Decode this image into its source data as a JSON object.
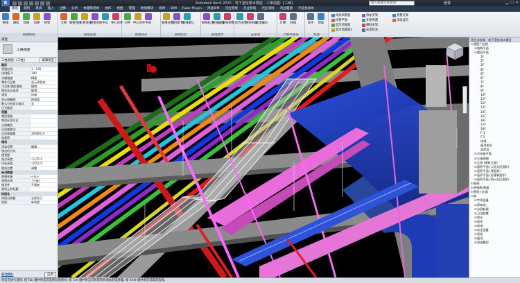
{
  "app": {
    "title": "Autodesk Revit 2016 - 地下室给排水模型 - 三维视图: {三维}",
    "search_placeholder": "键入关键字或短语",
    "login_label": "登录",
    "app_button": "R"
  },
  "tabs": [
    "建筑",
    "结构",
    "系统",
    "插入",
    "注释",
    "分析",
    "体量和场地",
    "协作",
    "视图",
    "管理",
    "附加模块",
    "修改",
    "BIM",
    "Fuzor Plugin",
    "鸿业BIM",
    "鸿业管线",
    "鸿业机电",
    "鸿业消防",
    "鸿业暖通",
    "鸿业给排水"
  ],
  "active_tab": 0,
  "ribbon": {
    "groups": [
      {
        "label": "管线绘制",
        "buttons": [
          "管线",
          "通风",
          "喷淋",
          "风管",
          "桥架"
        ]
      },
      {
        "label": "管线连接",
        "buttons": [
          "立管",
          "两管连接",
          "三管连接",
          "四管连接",
          "中心",
          "中心对齐"
        ]
      },
      {
        "label": "管线对齐",
        "buttons": [
          "对齐",
          "中心对齐",
          "中间",
          "管线平移"
        ]
      },
      {
        "label": "管线综合",
        "buttons": [
          "管线分割",
          "管线打断",
          "管线避让",
          "管线调整"
        ]
      },
      {
        "label": "管线修改",
        "buttons": [
          "管线标注",
          "管线编辑",
          "管线参数"
        ]
      },
      {
        "label": "支吊架",
        "buttons": [
          "综合支架",
          "吊架布置",
          "支架编号"
        ]
      },
      {
        "label": "计算书管理",
        "buttons": [
          "计算",
          "校核"
        ]
      },
      {
        "label": "帮助",
        "buttons": [
          "关于",
          "帮助",
          "授权"
        ]
      }
    ],
    "small_items": [
      "添加风管面",
      "风管平面",
      "显示风管面",
      "显示风管面2",
      "添加支架",
      "支架布置",
      "删除支架",
      "支架标注",
      "查看支架",
      "净高显示"
    ]
  },
  "properties": {
    "header": "属性",
    "type_name": "三维视图",
    "selector": "三维视图: {三维}",
    "edit_type": "编辑类型",
    "rows": [
      {
        "cat": "图形"
      },
      {
        "k": "视图比例",
        "v": "1 : 100"
      },
      {
        "k": "比例值 1:",
        "v": "100"
      },
      {
        "k": "详细程度",
        "v": "精细"
      },
      {
        "k": "零件可见性",
        "v": "显示原状态"
      },
      {
        "k": "可见性/图形替换",
        "v": "编辑..."
      },
      {
        "k": "图形显示选项",
        "v": "编辑..."
      },
      {
        "k": "规程",
        "v": "协调"
      },
      {
        "k": "显示隐藏线",
        "v": "按规程"
      },
      {
        "k": "默认分析显示样式",
        "v": "无"
      },
      {
        "k": "日光路径",
        "v": ""
      },
      {
        "cat": "范围"
      },
      {
        "k": "裁剪视图",
        "v": ""
      },
      {
        "k": "裁剪区域可见",
        "v": ""
      },
      {
        "k": "注释裁剪",
        "v": ""
      },
      {
        "k": "远剪裁激活",
        "v": ""
      },
      {
        "k": "远剪裁偏移",
        "v": "304800.0"
      },
      {
        "k": "剖面框",
        "v": ""
      },
      {
        "cat": "相机"
      },
      {
        "k": "渲染设置",
        "v": "编辑..."
      },
      {
        "k": "锁定的方向",
        "v": ""
      },
      {
        "k": "透视图",
        "v": ""
      },
      {
        "k": "视点高度",
        "v": "-1175.2"
      },
      {
        "k": "目标高度",
        "v": "-2552.5"
      },
      {
        "k": "相机位置",
        "v": "调整"
      },
      {
        "cat": "标识数据"
      },
      {
        "k": "视图样板",
        "v": "<无>"
      },
      {
        "k": "视图名称",
        "v": "{三维}"
      },
      {
        "k": "相关性",
        "v": "不相关"
      },
      {
        "k": "图纸上的标题",
        "v": ""
      },
      {
        "cat": "阶段化"
      },
      {
        "k": "阶段过滤器",
        "v": "全部显示"
      },
      {
        "k": "阶段",
        "v": "新构造"
      }
    ],
    "help_link": "属性帮助",
    "apply_label": "应用"
  },
  "browser": {
    "header": "项目浏览器 - 地下室给排水模型",
    "items": [
      {
        "t": "视图 (全部)",
        "lvl": 0,
        "g": "⊟"
      },
      {
        "t": "结构平面",
        "lvl": 1,
        "g": "⊞"
      },
      {
        "t": "楼层平面",
        "lvl": 1,
        "g": "⊟"
      },
      {
        "t": "1F",
        "lvl": 2,
        "g": ""
      },
      {
        "t": "2F",
        "lvl": 2,
        "g": ""
      },
      {
        "t": "3F",
        "lvl": 2,
        "g": ""
      },
      {
        "t": "4F",
        "lvl": 2,
        "g": ""
      },
      {
        "t": "5F",
        "lvl": 2,
        "g": ""
      },
      {
        "t": "6F",
        "lvl": 2,
        "g": ""
      },
      {
        "t": "7F",
        "lvl": 2,
        "g": ""
      },
      {
        "t": "8F",
        "lvl": 2,
        "g": ""
      },
      {
        "t": "9F",
        "lvl": 2,
        "g": ""
      },
      {
        "t": "10F",
        "lvl": 2,
        "g": ""
      },
      {
        "t": "11F",
        "lvl": 2,
        "g": ""
      },
      {
        "t": "12F",
        "lvl": 2,
        "g": ""
      },
      {
        "t": "13F",
        "lvl": 2,
        "g": ""
      },
      {
        "t": "14F",
        "lvl": 2,
        "g": ""
      },
      {
        "t": "15F",
        "lvl": 2,
        "g": ""
      },
      {
        "t": "16F",
        "lvl": 2,
        "g": ""
      },
      {
        "t": "17F",
        "lvl": 2,
        "g": ""
      },
      {
        "t": "18F",
        "lvl": 2,
        "g": ""
      },
      {
        "t": "F-1",
        "lvl": 2,
        "g": ""
      },
      {
        "t": "F-2",
        "lvl": 2,
        "g": ""
      },
      {
        "t": "场地",
        "lvl": 2,
        "g": ""
      },
      {
        "t": "屋顶排水",
        "lvl": 2,
        "g": ""
      },
      {
        "t": "机房层",
        "lvl": 2,
        "g": ""
      },
      {
        "t": "天花板平面",
        "lvl": 1,
        "g": "⊞"
      },
      {
        "t": "三维视图",
        "lvl": 1,
        "g": "⊞"
      },
      {
        "t": "立面 (建筑立面)",
        "lvl": 1,
        "g": "⊞"
      },
      {
        "t": "面积平面 (人防分区面积)",
        "lvl": 1,
        "g": "⊞"
      },
      {
        "t": "面积平面 (净面积)",
        "lvl": 1,
        "g": "⊞"
      },
      {
        "t": "面积平面 (总建筑面积)",
        "lvl": 1,
        "g": "⊞"
      },
      {
        "t": "面积平面 (防火分区面积)",
        "lvl": 1,
        "g": "⊞"
      },
      {
        "t": "图例",
        "lvl": 0,
        "g": "⊞"
      },
      {
        "t": "明细表/数量",
        "lvl": 0,
        "g": "⊞"
      },
      {
        "t": "图纸 (全部)",
        "lvl": 0,
        "g": "⊞"
      },
      {
        "t": "族",
        "lvl": 0,
        "g": "⊟"
      },
      {
        "t": "专用设备",
        "lvl": 1,
        "g": "⊞"
      },
      {
        "t": "停车场",
        "lvl": 1,
        "g": "⊞"
      },
      {
        "t": "分割轮廓",
        "lvl": 1,
        "g": "⊞"
      },
      {
        "t": "卫浴装置",
        "lvl": 1,
        "g": "⊞"
      },
      {
        "t": "喷头",
        "lvl": 1,
        "g": "⊞"
      },
      {
        "t": "地形",
        "lvl": 1,
        "g": "⊞"
      },
      {
        "t": "场地",
        "lvl": 1,
        "g": "⊞"
      },
      {
        "t": "安全设备",
        "lvl": 1,
        "g": "⊞"
      },
      {
        "t": "家具",
        "lvl": 1,
        "g": "⊞"
      },
      {
        "t": "屋顶",
        "lvl": 1,
        "g": "⊞"
      },
      {
        "t": "常规模型",
        "lvl": 1,
        "g": "⊞"
      }
    ]
  },
  "view_control": {
    "scale": "1 : 100"
  },
  "status_text": "单击可进行选择; 按 Tab 键并单击可选择其他项目; 按 Ctrl 键并单击可将新项目添加到选择集; 按 Shift 键并单击可取消选择。",
  "colors": {
    "ribbon_bg": "#e6ebf1",
    "tab_bar": "#2b3a4d",
    "duct_blue": "#1f3fbf",
    "pink": "#e36ad4",
    "beam_gray": "#8a8a8a"
  }
}
